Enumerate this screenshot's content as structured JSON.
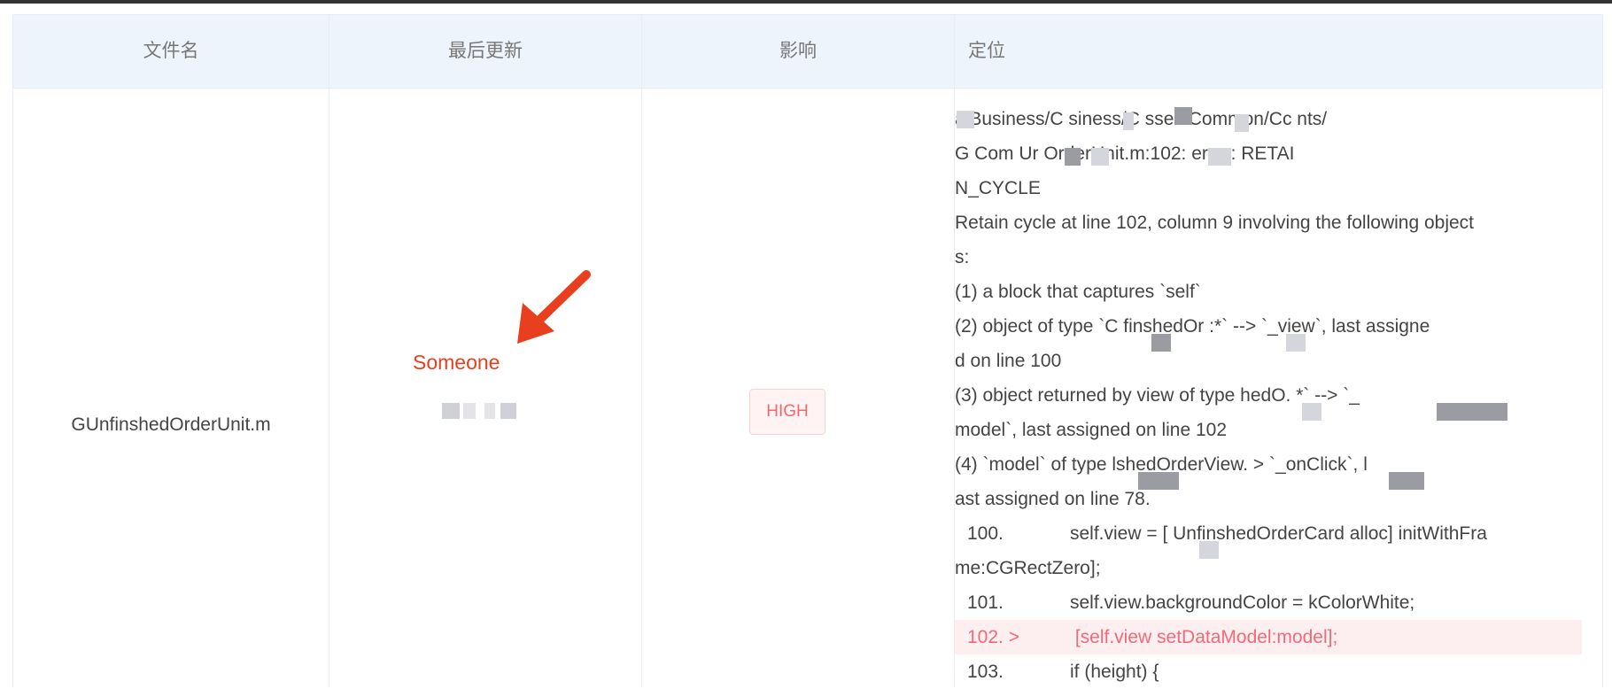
{
  "table": {
    "headers": [
      "文件名",
      "最后更新",
      "影响",
      "定位"
    ],
    "row": {
      "file": "GUnfinshedOrderUnit.m",
      "annotation_label": "Someone",
      "impact": "HIGH",
      "location_lines": [
        "  alBusiness/C          siness/C   sses/Common/Cc        nts/",
        "G                        Com    Ur          OrderUnit.m:102: error: RETAI",
        "N_CYCLE",
        " Retain cycle at line 102, column 9 involving the following object",
        "s:",
        " (1) a block that captures `self`",
        " (2) object of type `C    finshedOr          :*` --> `_view`, last assigne",
        "d on line 100",
        " (3) object returned by view of type             hedO.          *` --> `_",
        "model`, last assigned on line 102",
        " (4) `model` of type            lshedOrderView.              > `_onClick`, l",
        "ast assigned on line 78."
      ],
      "code_lines": [
        {
          "num": "100.",
          "code": "self.view = [    UnfinshedOrderCard alloc] initWithFra",
          "highlight": false
        },
        {
          "num": "",
          "code": "me:CGRectZero];",
          "highlight": false,
          "continuation": true
        },
        {
          "num": "101.",
          "code": "self.view.backgroundColor = kColorWhite;",
          "highlight": false
        },
        {
          "num": "102. >",
          "code": " [self.view setDataModel:model];",
          "highlight": true
        },
        {
          "num": "103.",
          "code": "if (height) {",
          "highlight": false
        }
      ]
    }
  },
  "colors": {
    "header_bg": "#eef4fc",
    "badge_text": "#ef6b6b",
    "badge_bg": "#fff3f3",
    "highlight_bg": "#fdeef0",
    "annotation": "#e8401f"
  }
}
